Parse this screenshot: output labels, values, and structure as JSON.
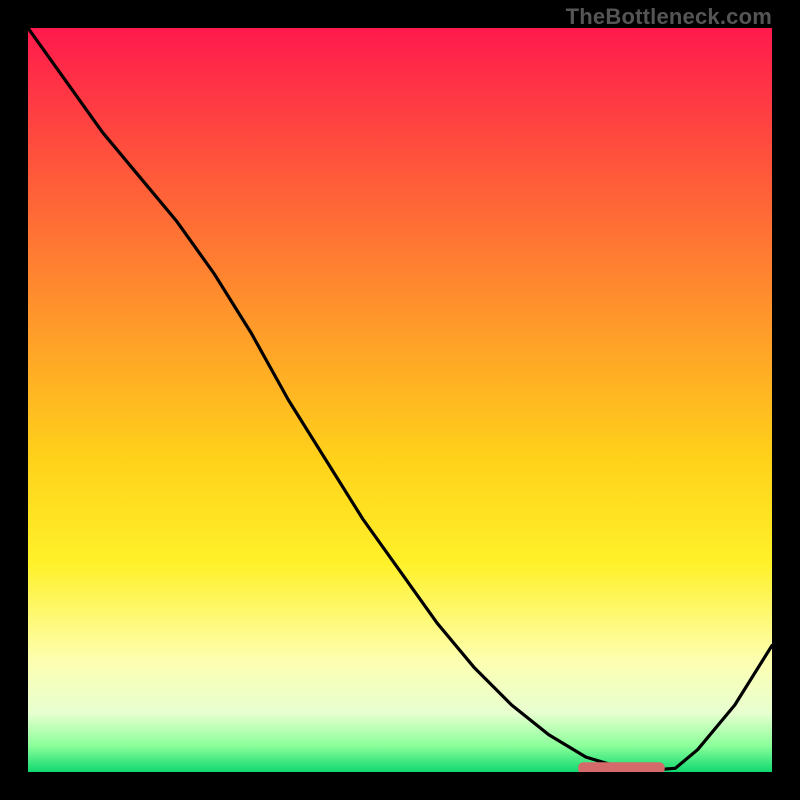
{
  "watermark": "TheBottleneck.com",
  "colors": {
    "black": "#000000",
    "line": "#000000",
    "marker": "#d46a6a",
    "gradient_stops": [
      {
        "offset": 0.0,
        "color": "#ff1a4d"
      },
      {
        "offset": 0.2,
        "color": "#ff5a3a"
      },
      {
        "offset": 0.4,
        "color": "#ff9a2a"
      },
      {
        "offset": 0.58,
        "color": "#ffd21a"
      },
      {
        "offset": 0.72,
        "color": "#fff12a"
      },
      {
        "offset": 0.85,
        "color": "#fdffb0"
      },
      {
        "offset": 0.92,
        "color": "#e8ffd0"
      },
      {
        "offset": 0.965,
        "color": "#8aff9a"
      },
      {
        "offset": 1.0,
        "color": "#10d870"
      }
    ]
  },
  "chart_data": {
    "type": "line",
    "title": "",
    "xlabel": "",
    "ylabel": "",
    "xlim": [
      0,
      1
    ],
    "ylim": [
      0,
      1
    ],
    "series": [
      {
        "name": "curve",
        "x": [
          0.0,
          0.05,
          0.1,
          0.15,
          0.2,
          0.25,
          0.3,
          0.35,
          0.4,
          0.45,
          0.5,
          0.55,
          0.6,
          0.65,
          0.7,
          0.75,
          0.8,
          0.83,
          0.87,
          0.9,
          0.95,
          1.0
        ],
        "y": [
          1.0,
          0.93,
          0.86,
          0.8,
          0.74,
          0.67,
          0.59,
          0.5,
          0.42,
          0.34,
          0.27,
          0.2,
          0.14,
          0.09,
          0.05,
          0.02,
          0.005,
          0.002,
          0.005,
          0.03,
          0.09,
          0.17
        ]
      }
    ],
    "marker": {
      "x0": 0.74,
      "x1": 0.855,
      "y": 0.005,
      "thickness": 0.015
    }
  }
}
